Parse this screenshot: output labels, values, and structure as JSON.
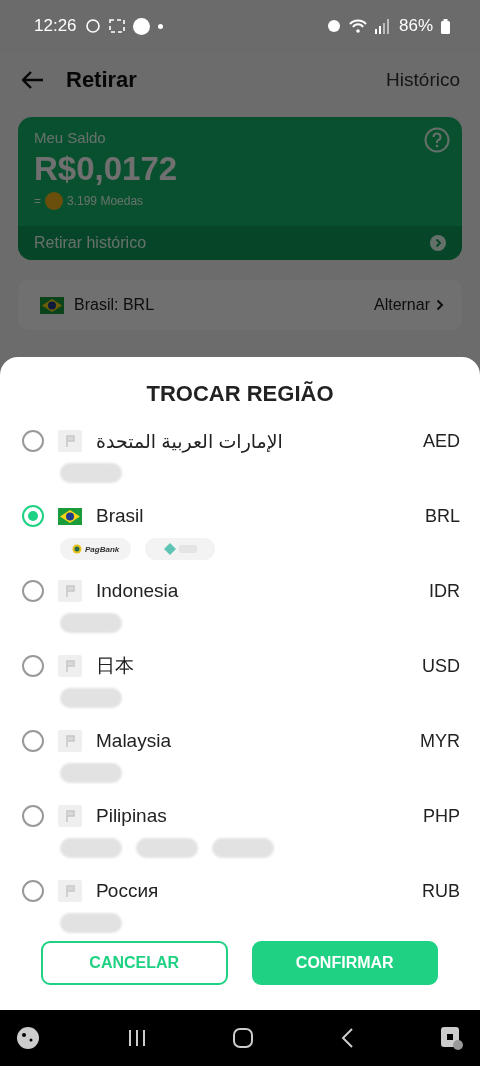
{
  "status_bar": {
    "time": "12:26",
    "battery": "86%"
  },
  "header": {
    "title": "Retirar",
    "action": "Histórico"
  },
  "balance_card": {
    "label": "Meu Saldo",
    "amount": "R$0,0172",
    "coins_prefix": "=",
    "coins": "3.199 Moedas",
    "history_link": "Retirar histórico"
  },
  "current_region": {
    "label": "Brasil: BRL",
    "flag": {
      "kind": "brazil"
    },
    "action": "Alternar"
  },
  "sheet": {
    "title": "TROCAR REGIÃO",
    "regions": [
      {
        "name": "الإمارات العربية المتحدة",
        "currency": "AED",
        "flag": {
          "kind": "placeholder"
        },
        "selected": false,
        "methods": [
          {
            "kind": "placeholder"
          }
        ]
      },
      {
        "name": "Brasil",
        "currency": "BRL",
        "flag": {
          "kind": "brazil"
        },
        "selected": true,
        "methods": [
          {
            "kind": "pagbank",
            "label": "PagBank"
          },
          {
            "kind": "pix"
          }
        ]
      },
      {
        "name": "Indonesia",
        "currency": "IDR",
        "flag": {
          "kind": "placeholder"
        },
        "selected": false,
        "methods": [
          {
            "kind": "placeholder"
          }
        ]
      },
      {
        "name": "日本",
        "currency": "USD",
        "flag": {
          "kind": "placeholder"
        },
        "selected": false,
        "methods": [
          {
            "kind": "placeholder"
          }
        ]
      },
      {
        "name": "Malaysia",
        "currency": "MYR",
        "flag": {
          "kind": "placeholder"
        },
        "selected": false,
        "methods": [
          {
            "kind": "placeholder"
          }
        ]
      },
      {
        "name": "Pilipinas",
        "currency": "PHP",
        "flag": {
          "kind": "placeholder"
        },
        "selected": false,
        "methods": [
          {
            "kind": "placeholder"
          },
          {
            "kind": "placeholder"
          },
          {
            "kind": "placeholder"
          }
        ]
      },
      {
        "name": "Россия",
        "currency": "RUB",
        "flag": {
          "kind": "placeholder"
        },
        "selected": false,
        "methods": [
          {
            "kind": "placeholder"
          }
        ]
      }
    ],
    "buttons": [
      {
        "kind": "outline",
        "label": "CANCELAR"
      },
      {
        "kind": "filled",
        "label": "CONFIRMAR"
      }
    ]
  }
}
